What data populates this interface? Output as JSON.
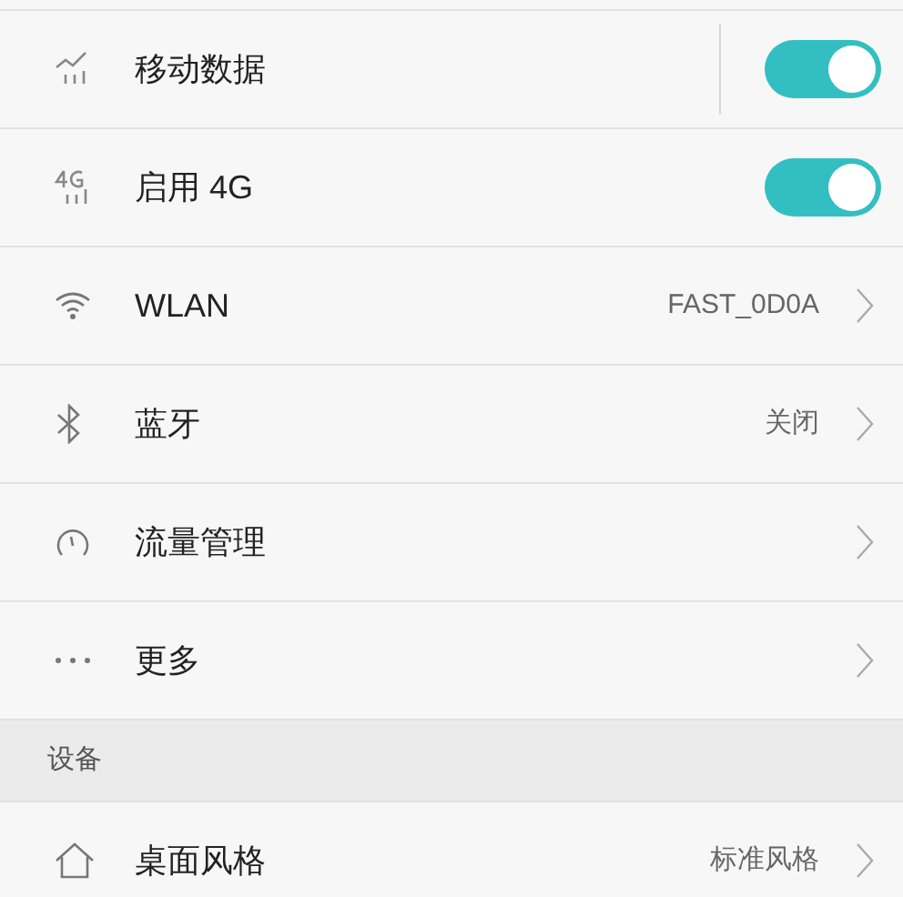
{
  "rows": [
    {
      "kind": "toggle",
      "label": "移动数据",
      "on": true,
      "divider": true
    },
    {
      "kind": "toggle",
      "label": "启用 4G",
      "on": true
    },
    {
      "kind": "link",
      "label": "WLAN",
      "value": "FAST_0D0A"
    },
    {
      "kind": "link",
      "label": "蓝牙",
      "value": "关闭"
    },
    {
      "kind": "link",
      "label": "流量管理"
    },
    {
      "kind": "link",
      "label": "更多"
    },
    {
      "kind": "section",
      "label": "设备"
    },
    {
      "kind": "link",
      "label": "桌面风格",
      "value": "标准风格"
    }
  ]
}
